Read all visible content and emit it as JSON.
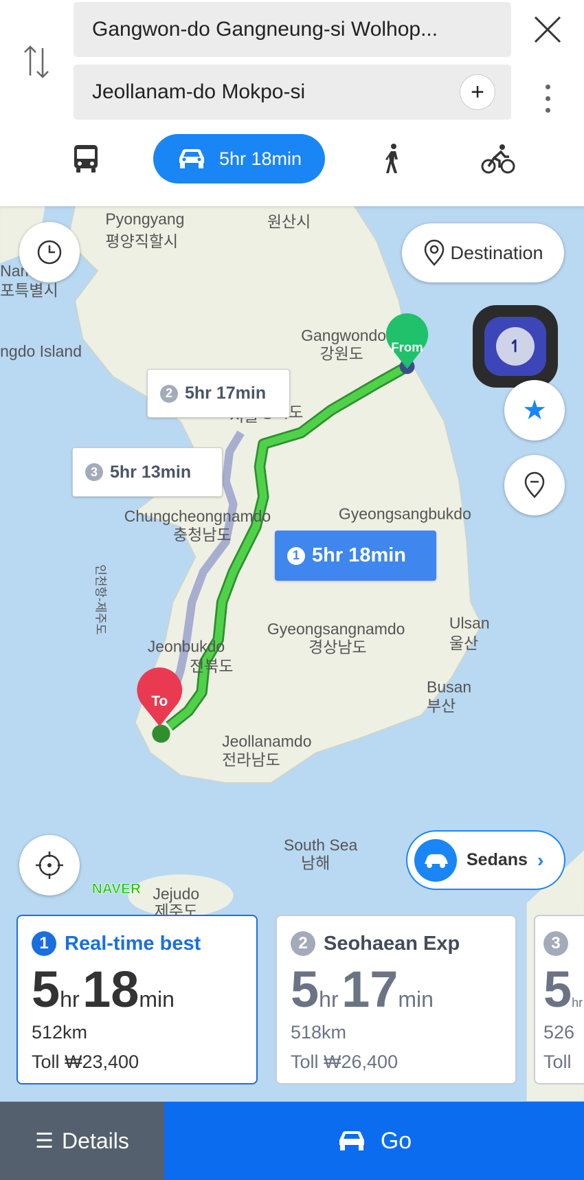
{
  "header": {
    "origin": "Gangwon-do Gangneung-si Wolhop...",
    "destination": "Jeollanam-do Mokpo-si",
    "modes": [
      {
        "icon": "bus-icon"
      },
      {
        "icon": "car-icon",
        "label": "5hr 18min",
        "active": true
      },
      {
        "icon": "walk-icon"
      },
      {
        "icon": "bicycle-icon"
      }
    ]
  },
  "map": {
    "destination_button": "Destination",
    "sedans_button": "Sedans",
    "logo": "NAVER",
    "from_marker": "From",
    "to_marker": "To",
    "route_labels": [
      {
        "num": "1",
        "time": "5hr 18min"
      },
      {
        "num": "2",
        "time": "5hr 17min"
      },
      {
        "num": "3",
        "time": "5hr 13min"
      }
    ],
    "places": [
      "Pyongyang",
      "평양직할시",
      "원산시",
      "Gangwondo",
      "강원도",
      "서울",
      "경기도",
      "Chungcheongnamdo",
      "충청남도",
      "Gyeongsangbukdo",
      "Gyeongsangnamdo",
      "경상남도",
      "Ulsan",
      "울산",
      "Busan",
      "부산",
      "Jeonbukdo",
      "전북도",
      "Jeollanamdo",
      "전라남도",
      "South Sea",
      "남해",
      "Jejudo",
      "제주도",
      "Nam",
      "포특별시",
      "ngdo Island",
      "인천항-제주도"
    ],
    "colors": {
      "route_active": "#3cb83c",
      "route_alt": "#a7aed0",
      "accent": "#1a86f5"
    }
  },
  "routes": [
    {
      "num": "1",
      "name": "Real-time best",
      "hr": "5",
      "min": "18",
      "hr_unit": "hr",
      "min_unit": "min",
      "distance": "512km",
      "toll": "Toll ₩23,400",
      "selected": true
    },
    {
      "num": "2",
      "name": "Seohaean Exp",
      "hr": "5",
      "min": "17",
      "hr_unit": "hr",
      "min_unit": "min",
      "distance": "518km",
      "toll": "Toll ₩26,400"
    },
    {
      "num": "3",
      "name": "",
      "hr": "5",
      "min": "",
      "hr_unit": "hr",
      "min_unit": "",
      "distance": "526",
      "toll": "Toll"
    }
  ],
  "bottom": {
    "details": "Details",
    "go": "Go"
  }
}
